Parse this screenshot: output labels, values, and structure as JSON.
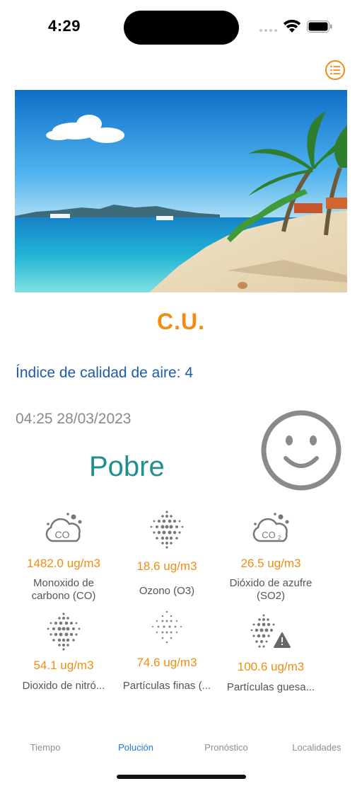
{
  "status_bar": {
    "time": "4:29"
  },
  "header": {
    "menu_icon": "list-icon"
  },
  "location": {
    "name": "C.U."
  },
  "air_quality": {
    "index_text": "Índice de calidad de aire: 4",
    "datetime": "04:25 28/03/2023",
    "level": "Pobre",
    "face_icon": "smiley-face-icon"
  },
  "pollutants": [
    {
      "icon": "cloud-co-icon",
      "value": "1482.0 ug/m3",
      "name_line1": "Monoxido de",
      "name_line2": "carbono (CO)"
    },
    {
      "icon": "particles-dots-icon",
      "value": "18.6 ug/m3",
      "name_line1": "Ozono (O3)",
      "name_line2": ""
    },
    {
      "icon": "cloud-co2-icon",
      "value": "26.5 ug/m3",
      "name_line1": "Dióxido de azufre",
      "name_line2": "(SO2)"
    },
    {
      "icon": "particles-dots-icon",
      "value": "54.1 ug/m3",
      "name_line1": "Dioxido de nitró...",
      "name_line2": ""
    },
    {
      "icon": "fine-particles-icon",
      "value": "74.6 ug/m3",
      "name_line1": "Partículas finas (...",
      "name_line2": ""
    },
    {
      "icon": "particles-warning-icon",
      "value": "100.6 ug/m3",
      "name_line1": "Partículas guesa...",
      "name_line2": ""
    }
  ],
  "tabs": [
    {
      "label": "Tiempo",
      "active": false
    },
    {
      "label": "Polución",
      "active": true
    },
    {
      "label": "Pronóstico",
      "active": false
    },
    {
      "label": "Localidades",
      "active": false
    }
  ],
  "colors": {
    "accent_orange": "#f28c12",
    "link_blue": "#1d5da8",
    "quality_teal": "#1f8f8f",
    "tab_active": "#1e7be0"
  }
}
